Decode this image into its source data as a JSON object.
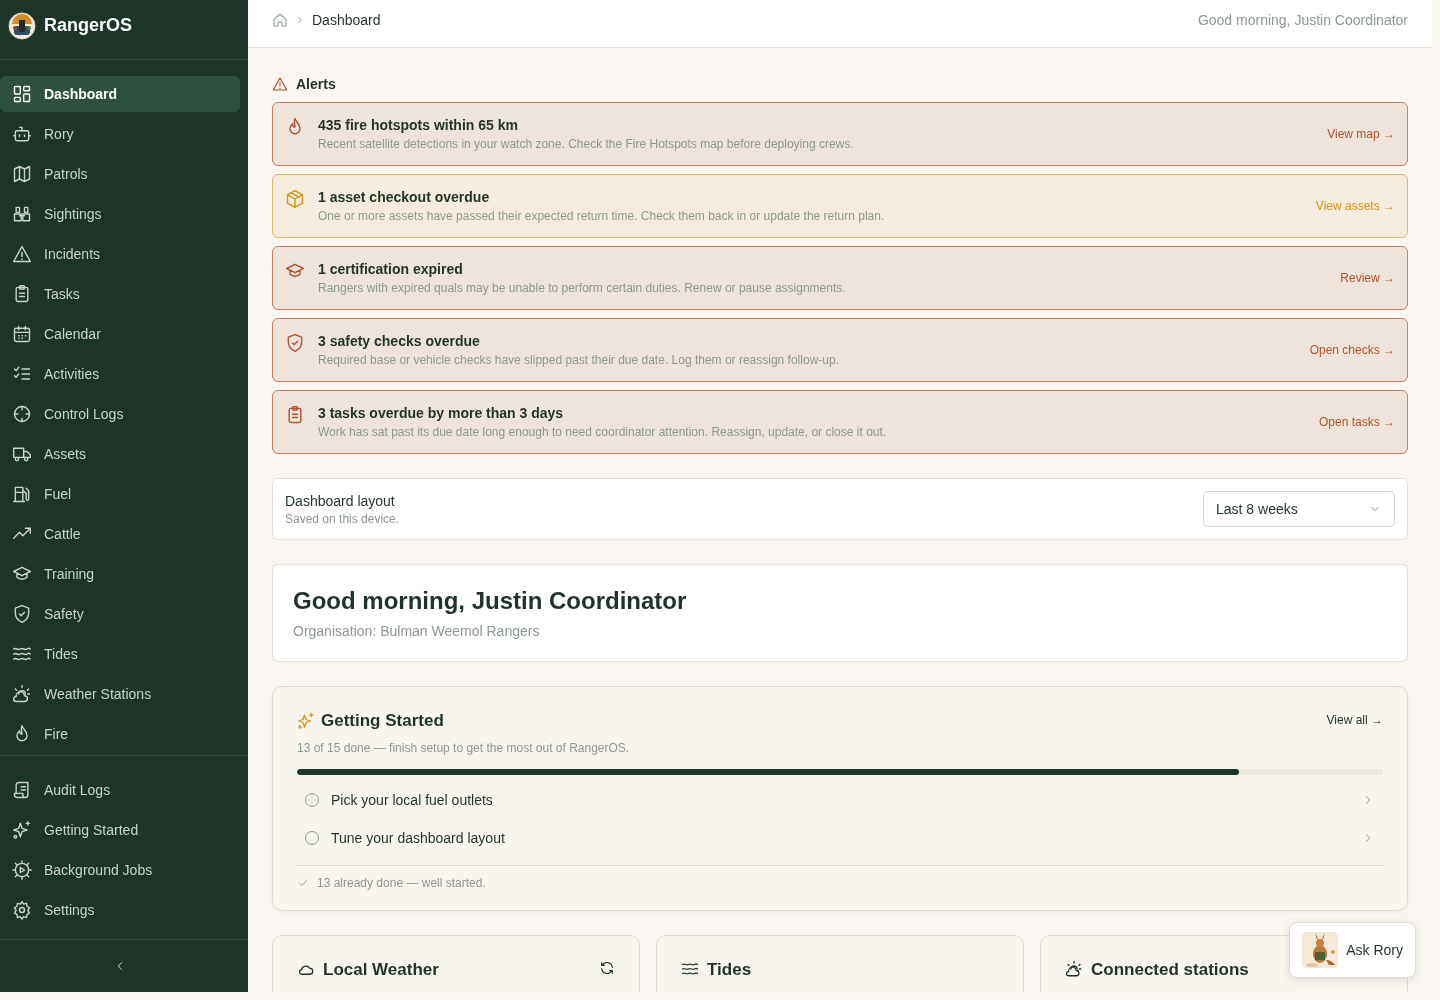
{
  "brand": {
    "name": "RangerOS"
  },
  "sidebar": {
    "items": [
      {
        "label": "Dashboard",
        "selected": true
      },
      {
        "label": "Rory",
        "selected": false
      },
      {
        "label": "Patrols",
        "selected": false
      },
      {
        "label": "Sightings",
        "selected": false
      },
      {
        "label": "Incidents",
        "selected": false
      },
      {
        "label": "Tasks",
        "selected": false
      },
      {
        "label": "Calendar",
        "selected": false
      },
      {
        "label": "Activities",
        "selected": false
      },
      {
        "label": "Control Logs",
        "selected": false
      },
      {
        "label": "Assets",
        "selected": false
      },
      {
        "label": "Fuel",
        "selected": false
      },
      {
        "label": "Cattle",
        "selected": false
      },
      {
        "label": "Training",
        "selected": false
      },
      {
        "label": "Safety",
        "selected": false
      },
      {
        "label": "Tides",
        "selected": false
      },
      {
        "label": "Weather Stations",
        "selected": false
      },
      {
        "label": "Fire",
        "selected": false
      }
    ],
    "secondary_items": [
      {
        "label": "Audit Logs",
        "selected": false
      },
      {
        "label": "Getting Started",
        "selected": false
      },
      {
        "label": "Background Jobs",
        "selected": false
      },
      {
        "label": "Settings",
        "selected": false
      }
    ]
  },
  "header": {
    "breadcrumb": "Dashboard",
    "greeting": "Good morning, Justin Coordinator"
  },
  "alerts": {
    "title": "Alerts",
    "items": [
      {
        "kind": "danger",
        "title": "435 fire hotspots within 65 km",
        "description": "Recent satellite detections in your watch zone. Check the Fire Hotspots map before deploying crews.",
        "action": "View map →"
      },
      {
        "kind": "warning",
        "title": "1 asset checkout overdue",
        "description": "One or more assets have passed their expected return time. Check them back in or update the return plan.",
        "action": "View assets →"
      },
      {
        "kind": "danger",
        "title": "1 certification expired",
        "description": "Rangers with expired quals may be unable to perform certain duties. Renew or pause assignments.",
        "action": "Review →"
      },
      {
        "kind": "danger",
        "title": "3 safety checks overdue",
        "description": "Required base or vehicle checks have slipped past their due date. Log them or reassign follow-up.",
        "action": "Open checks →"
      },
      {
        "kind": "danger",
        "title": "3 tasks overdue by more than 3 days",
        "description": "Work has sat past its due date long enough to need coordinator attention. Reassign, update, or close it out.",
        "action": "Open tasks →"
      }
    ]
  },
  "layout": {
    "title": "Dashboard layout",
    "subtitle": "Saved on this device.",
    "range": "Last 8 weeks"
  },
  "welcome": {
    "title": "Good morning, Justin Coordinator",
    "organisation": "Organisation: Bulman Weemol Rangers"
  },
  "getting_started": {
    "title": "Getting Started",
    "summary": "13 of 15 done — finish setup to get the most out of RangerOS.",
    "action": "View all →",
    "level": 0.867,
    "steps": [
      {
        "label": "Pick your local fuel outlets",
        "checked": false
      },
      {
        "label": "Tune your dashboard layout",
        "checked": false
      }
    ],
    "footer": "13 already done — well started."
  },
  "cards": [
    {
      "title": "Local Weather"
    },
    {
      "title": "Tides"
    },
    {
      "title": "Connected stations"
    }
  ],
  "assistant": {
    "label": "Ask Rory"
  }
}
